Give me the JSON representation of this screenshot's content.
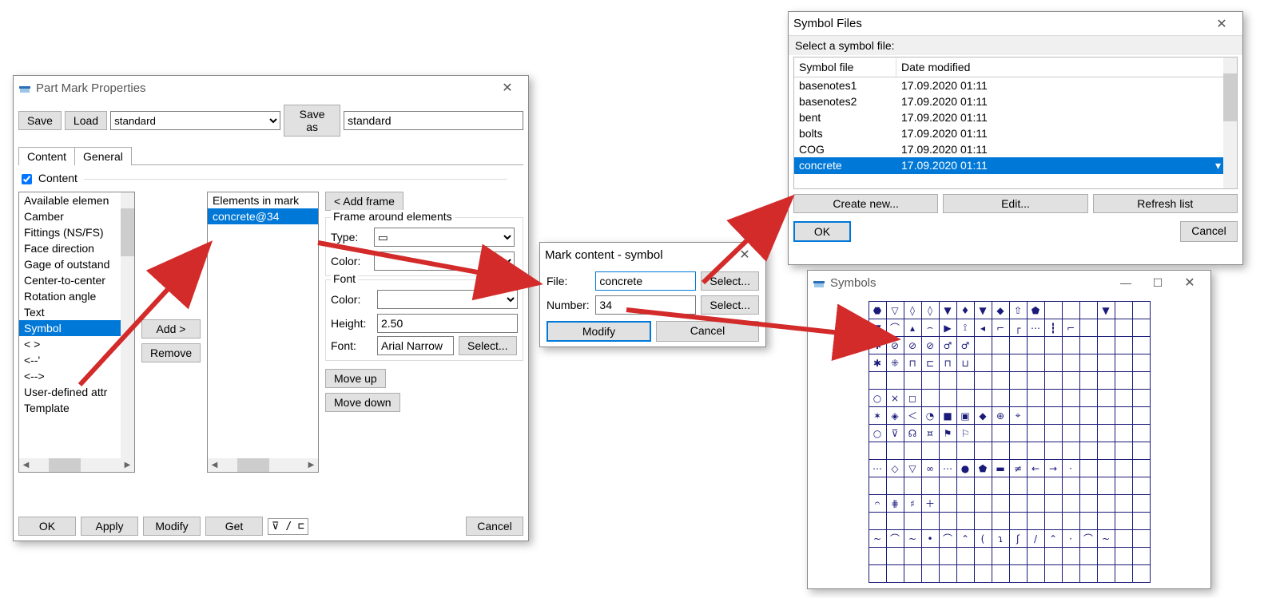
{
  "win1": {
    "title": "Part Mark Properties",
    "save": "Save",
    "load": "Load",
    "saveas": "Save as",
    "preset": "standard",
    "saveas_value": "standard",
    "tabs": {
      "content": "Content",
      "general": "General"
    },
    "content_checkbox": "Content",
    "available_label": "Available elemen",
    "available_items": [
      "Camber",
      "Fittings (NS/FS)",
      "Face direction",
      "Gage of outstand",
      "Center-to-center",
      "Rotation angle",
      "Text",
      "Symbol",
      "<  >",
      "<--'",
      "<-->",
      "User-defined attr",
      "Template"
    ],
    "available_selected": "Symbol",
    "add": "Add >",
    "remove": "Remove",
    "elements_label": "Elements in mark",
    "elements_items": [
      "concrete@34"
    ],
    "addframe": "< Add frame",
    "frame_group": "Frame around elements",
    "type_lbl": "Type:",
    "color_lbl": "Color:",
    "font_group": "Font",
    "height_lbl": "Height:",
    "height_val": "2.50",
    "font_lbl": "Font:",
    "font_val": "Arial Narrow",
    "select": "Select...",
    "moveup": "Move up",
    "movedown": "Move down",
    "ok": "OK",
    "apply": "Apply",
    "modify": "Modify",
    "get": "Get",
    "cancel": "Cancel"
  },
  "win2": {
    "title": "Mark content - symbol",
    "file_lbl": "File:",
    "file_val": "concrete",
    "num_lbl": "Number:",
    "num_val": "34",
    "select": "Select...",
    "modify": "Modify",
    "cancel": "Cancel"
  },
  "win3": {
    "title": "Symbol Files",
    "prompt": "Select a symbol file:",
    "col1": "Symbol file",
    "col2": "Date modified",
    "rows": [
      {
        "name": "basenotes1",
        "date": "17.09.2020 01:11"
      },
      {
        "name": "basenotes2",
        "date": "17.09.2020 01:11"
      },
      {
        "name": "bent",
        "date": "17.09.2020 01:11"
      },
      {
        "name": "bolts",
        "date": "17.09.2020 01:11"
      },
      {
        "name": "COG",
        "date": "17.09.2020 01:11"
      },
      {
        "name": "concrete",
        "date": "17.09.2020 01:11"
      }
    ],
    "selected": "concrete",
    "create": "Create new...",
    "edit": "Edit...",
    "refresh": "Refresh list",
    "ok": "OK",
    "cancel": "Cancel"
  },
  "win4": {
    "title": "Symbols",
    "cells": [
      "⬣",
      "▽",
      "◊",
      "◊",
      "▼",
      "♦",
      "▼",
      "◆",
      "⇧",
      "⬟",
      "",
      "",
      "",
      "▼",
      "",
      "▼",
      "⌒",
      "▴",
      "⌢",
      "▶",
      "⟟",
      "◂",
      "⌐",
      "┌",
      "⋯",
      "┇",
      "⌐",
      "",
      "",
      "",
      "✱",
      "⊘",
      "⊘",
      "⊘",
      "♂",
      "♂",
      "",
      "",
      "",
      "",
      "",
      "",
      "",
      "",
      "",
      "✱",
      "⁜",
      "⊓",
      "⊏",
      "⊓",
      "⊔",
      "",
      "",
      "",
      "",
      "",
      "",
      "",
      "",
      "",
      "",
      "",
      "",
      "",
      "",
      "",
      "",
      "",
      "",
      "",
      "",
      "",
      "",
      "",
      "",
      "○",
      "×",
      "◻",
      "",
      "",
      "",
      "",
      "",
      "",
      "",
      "",
      "",
      "",
      "",
      "",
      "✶",
      "◈",
      "＜",
      "◔",
      "■",
      "▣",
      "◆",
      "⊕",
      "⌖",
      "",
      "",
      "",
      "",
      "",
      "",
      "○",
      "⊽",
      "☊",
      "¤",
      "⚑",
      "⚐",
      "",
      "",
      "",
      "",
      "",
      "",
      "",
      "",
      "",
      "",
      "",
      "",
      "",
      "",
      "",
      "",
      "",
      "",
      "",
      "",
      "",
      "",
      "",
      "",
      "⋯",
      "◇",
      "▽",
      "∞",
      "⋯",
      "●",
      "⬟",
      "▬",
      "≠",
      "←",
      "→",
      "·",
      "",
      "",
      "",
      "",
      "",
      "",
      "",
      "",
      "",
      "",
      "",
      "",
      "",
      "",
      "",
      "",
      "",
      "",
      "𝄐",
      "⋕",
      "♯",
      "＋",
      "",
      "",
      "",
      "",
      "",
      "",
      "",
      "",
      "",
      "",
      "",
      "",
      "",
      "",
      "",
      "",
      "",
      "",
      "",
      "",
      "",
      "",
      "",
      "",
      "",
      "",
      "~",
      "⌒",
      "~",
      "•",
      "⌒",
      "⌃",
      "(",
      "ɿ",
      "ʃ",
      "/",
      "⌃",
      "·",
      "⌒",
      "~",
      "",
      "",
      "",
      "",
      "",
      "",
      "",
      "",
      "",
      "",
      "",
      "",
      "",
      "",
      "",
      "",
      "",
      "",
      "",
      "",
      "",
      "",
      "",
      "",
      "",
      "",
      "",
      "",
      "",
      "",
      ""
    ]
  },
  "arrows_color": "#d32a2a"
}
